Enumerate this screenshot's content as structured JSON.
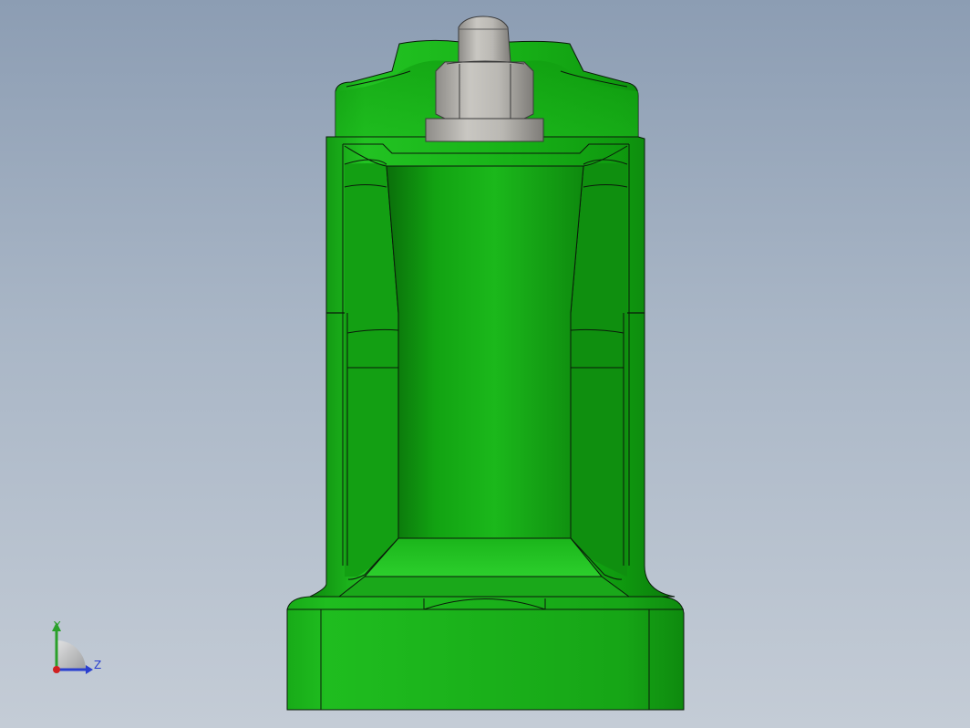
{
  "viewport": {
    "background_top": "#8c9db3",
    "background_bottom": "#c4ccd6"
  },
  "model": {
    "body_color": "#17b117",
    "body_light": "#2dd02d",
    "body_dark": "#0c7d0c",
    "base_color": "#16a516",
    "bolt_color": "#b7b5b0",
    "bolt_dark": "#7d7b77",
    "edge_color": "#0a1a0a"
  },
  "triad": {
    "y_label": "Y",
    "z_label": "Z",
    "y_color": "#2aa02a",
    "z_color": "#2a3fcf",
    "x_color": "#d02020"
  }
}
